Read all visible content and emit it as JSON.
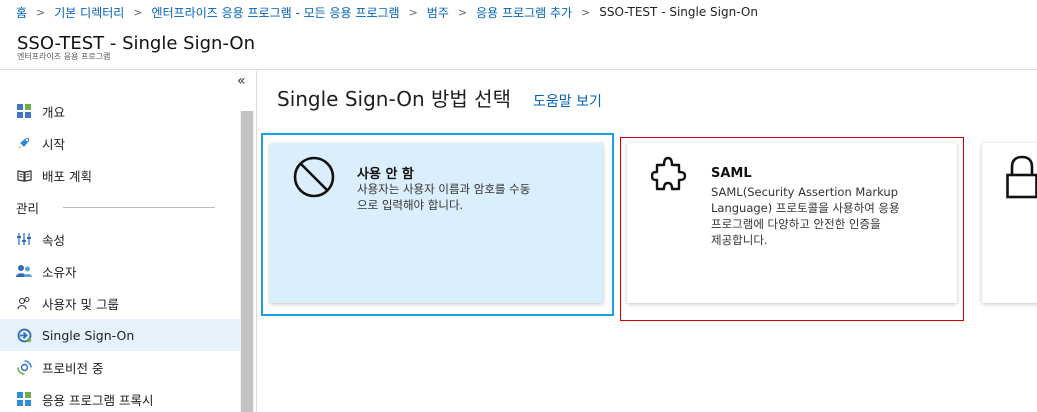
{
  "breadcrumb": {
    "items": [
      "홈",
      "기본 디렉터리",
      "엔터프라이즈 응용 프로그램 - 모든 응용 프로그램",
      "범주",
      "응용 프로그램 추가"
    ],
    "current": "SSO-TEST - Single Sign-On",
    "separator": ">"
  },
  "header": {
    "title": "SSO-TEST - Single Sign-On",
    "subtitle": "엔터프라이즈 응용 프로그램"
  },
  "sidebar": {
    "collapse_glyph": "«",
    "items": [
      {
        "label": "개요",
        "icon": "grid-icon"
      },
      {
        "label": "시작",
        "icon": "rocket-icon"
      },
      {
        "label": "배포 계획",
        "icon": "book-icon"
      }
    ],
    "section_label": "관리",
    "manage_items": [
      {
        "label": "속성",
        "icon": "properties-icon"
      },
      {
        "label": "소유자",
        "icon": "owners-icon"
      },
      {
        "label": "사용자 및 그룹",
        "icon": "users-icon"
      },
      {
        "label": "Single Sign-On",
        "icon": "sso-icon",
        "active": true
      },
      {
        "label": "프로비전 중",
        "icon": "provisioning-icon"
      },
      {
        "label": "응용 프로그램 프록시",
        "icon": "app-proxy-icon"
      }
    ]
  },
  "main": {
    "title": "Single Sign-On 방법 선택",
    "help_link": "도움말 보기",
    "cards": [
      {
        "title": "사용 안 함",
        "description_lines": [
          "사용자는 사용자 이름과 암호를 수동",
          "으로 입력해야 합니다."
        ],
        "icon": "disabled-icon",
        "state": "selected"
      },
      {
        "title": "SAML",
        "description_lines": [
          "SAML(Security Assertion Markup",
          "Language) 프로토콜을 사용하여 응용",
          "프로그램에 다양하고 안전한 인증을",
          "제공합니다."
        ],
        "icon": "puzzle-icon",
        "state": "highlighted"
      },
      {
        "title": "",
        "description_lines": [],
        "icon": "lock-icon",
        "state": "partial"
      }
    ]
  },
  "colors": {
    "link": "#0062b8",
    "selected_border": "#1aa1e0",
    "selected_fill": "#dbeefc",
    "highlight_border": "#d00000",
    "active_nav": "#e6f2fb"
  }
}
